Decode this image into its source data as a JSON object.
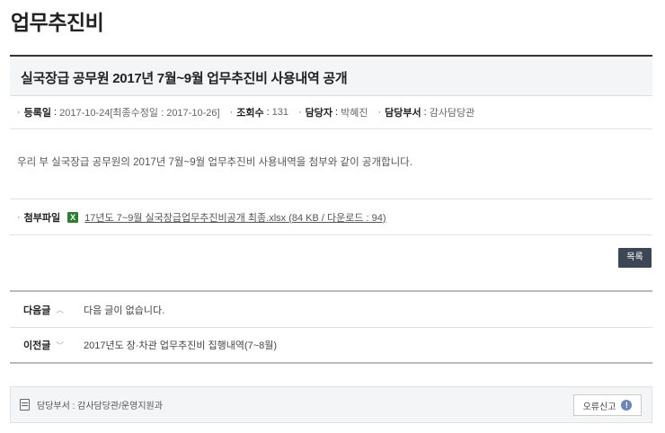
{
  "page": {
    "title": "업무추진비"
  },
  "post": {
    "title": "실국장급 공무원 2017년 7월~9월 업무추진비 사용내역 공개",
    "meta": [
      {
        "label": "등록일",
        "value": "2017-10-24[최종수정일 : 2017-10-26]"
      },
      {
        "label": "조회수",
        "value": "131"
      },
      {
        "label": "담당자",
        "value": "박혜진"
      },
      {
        "label": "담당부서",
        "value": "감사담당관"
      }
    ],
    "meta_bullet": "·",
    "meta_separator": ":",
    "content": "우리 부 실국장급 공무원의 2017년 7월~9월 업무추진비 사용내역을 첨부와 같이 공개합니다.",
    "attachment": {
      "label": "첨부파일",
      "icon": "excel-file-icon",
      "icon_glyph": "X",
      "file_text": "17년도 7~9월 실국장급업무추진비공개 최종.xlsx (84 KB / 다운로드 : 94)"
    }
  },
  "buttons": {
    "list_label": "목록",
    "report_label": "오류신고",
    "info_glyph": "!"
  },
  "nav": {
    "next": {
      "label": "다음글",
      "text": "다음 글이 없습니다.",
      "chevron": "︿"
    },
    "prev": {
      "label": "이전글",
      "text": "2017년도 장·차관 업무추진비 집행내역(7~8월)",
      "chevron": "﹀"
    }
  },
  "footer": {
    "department_text": "담당부서 : 감사담당관/운영지원과"
  },
  "colors": {
    "list_button_bg": "#3d4654",
    "excel_green": "#2e7d32",
    "info_blue": "#6b86b8"
  }
}
